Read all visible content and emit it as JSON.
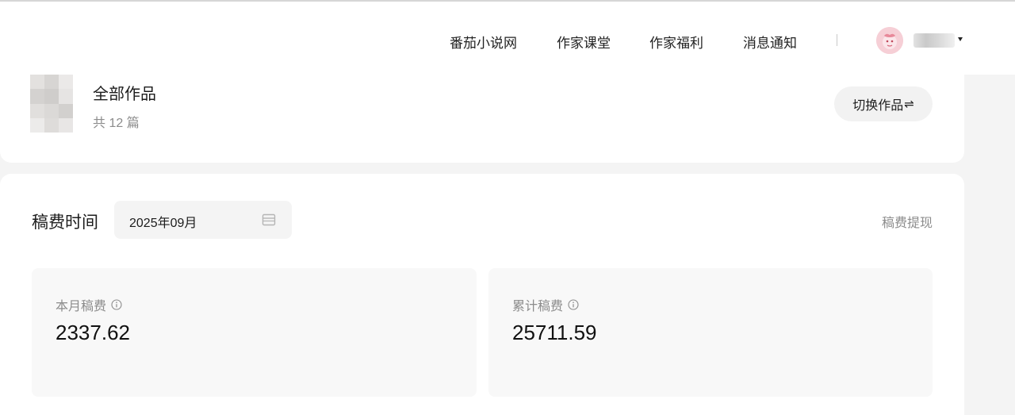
{
  "nav": {
    "links": [
      "番茄小说网",
      "作家课堂",
      "作家福利",
      "消息通知"
    ]
  },
  "works": {
    "title": "全部作品",
    "count": "共 12 篇",
    "switch_label": "切换作品",
    "switch_icon": "⇌"
  },
  "royalty": {
    "section_label": "稿费时间",
    "month_value": "2025年09月",
    "withdraw_label": "稿费提现",
    "monthly": {
      "label": "本月稿费",
      "value": "2337.62"
    },
    "total": {
      "label": "累计稿费",
      "value": "25711.59"
    }
  },
  "colors": {
    "accent_text": "#1d1d1d",
    "muted_text": "#8c8c8c",
    "panel_bg": "#f8f8f8",
    "page_bg": "#f4f4f4"
  }
}
